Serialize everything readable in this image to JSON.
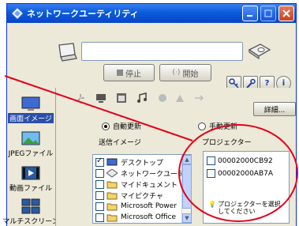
{
  "window": {
    "title": "ネットワークユーティリティ"
  },
  "toolbar": {
    "stop_label": "停止",
    "start_label": "開始",
    "help_label": "?",
    "info_label": "i"
  },
  "leftnav": {
    "items": [
      {
        "label": "画面イメージ",
        "icon": "screen-image-icon"
      },
      {
        "label": "JPEGファイル",
        "icon": "jpeg-file-icon"
      },
      {
        "label": "動画ファイル",
        "icon": "video-file-icon"
      },
      {
        "label": "マルチスクリーン",
        "icon": "multi-screen-icon"
      }
    ]
  },
  "content": {
    "detail_label": "詳細...",
    "auto_update_label": "自動更新",
    "manual_update_label": "手動更新",
    "send_image_label": "送信イメージ",
    "projector_label": "プロジェクター",
    "send_items": [
      {
        "label": "デスクトップ",
        "checked": true
      },
      {
        "label": "ネットワークユーテ",
        "checked": false
      },
      {
        "label": "マイドキュメント",
        "checked": false
      },
      {
        "label": "マイピクチャ",
        "checked": false
      },
      {
        "label": "Microsoft Power",
        "checked": false
      },
      {
        "label": "Microsoft Office",
        "checked": false
      }
    ],
    "projectors": [
      {
        "label": "00002000CB92"
      },
      {
        "label": "00002000AB7A"
      }
    ],
    "hint_text": "プロジェクターを選択してください"
  },
  "colors": {
    "title_blue": "#0a5bdc",
    "selected_nav": "#2c4fa8",
    "callout_red": "#e3001b"
  }
}
